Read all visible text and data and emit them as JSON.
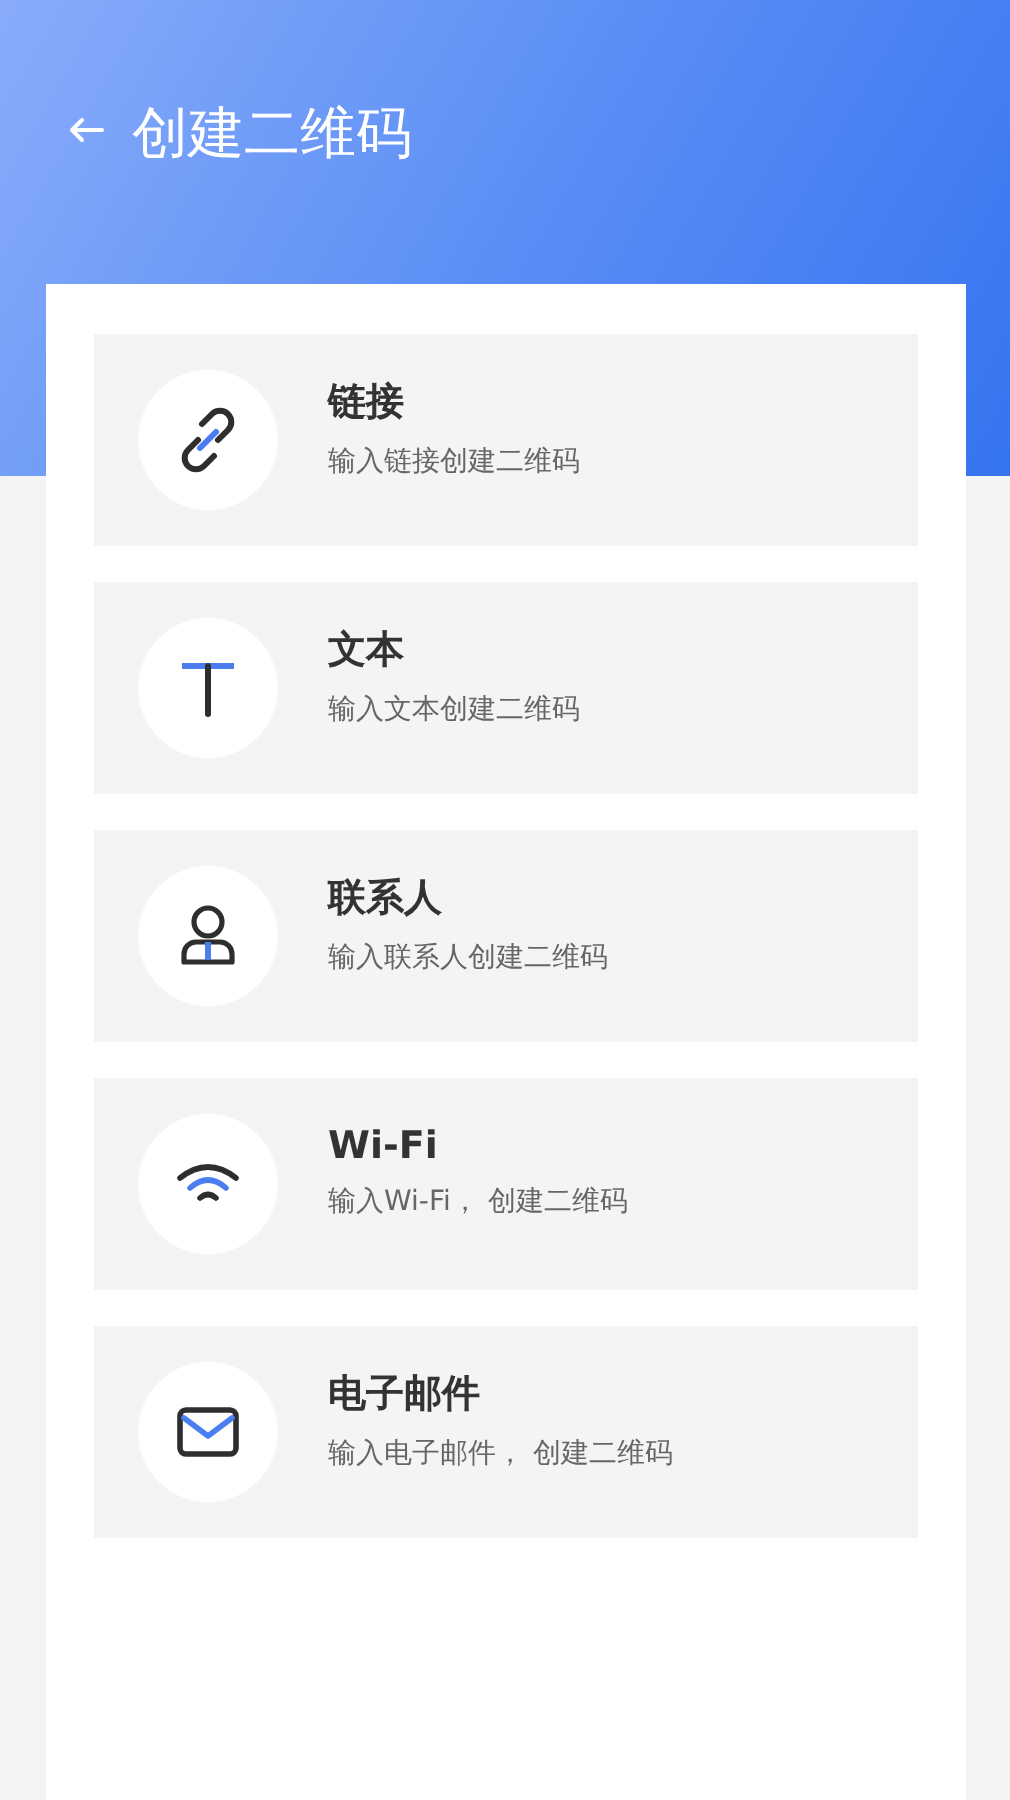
{
  "header": {
    "title": "创建二维码"
  },
  "options": [
    {
      "kind": "link",
      "title": "链接",
      "subtitle": "输入链接创建二维码"
    },
    {
      "kind": "text",
      "title": "文本",
      "subtitle": "输入文本创建二维码"
    },
    {
      "kind": "contact",
      "title": "联系人",
      "subtitle": "输入联系人创建二维码"
    },
    {
      "kind": "wifi",
      "title": "Wi-Fi",
      "subtitle": "输入Wi-Fi， 创建二维码"
    },
    {
      "kind": "email",
      "title": "电子邮件",
      "subtitle": "输入电子邮件， 创建二维码"
    }
  ]
}
